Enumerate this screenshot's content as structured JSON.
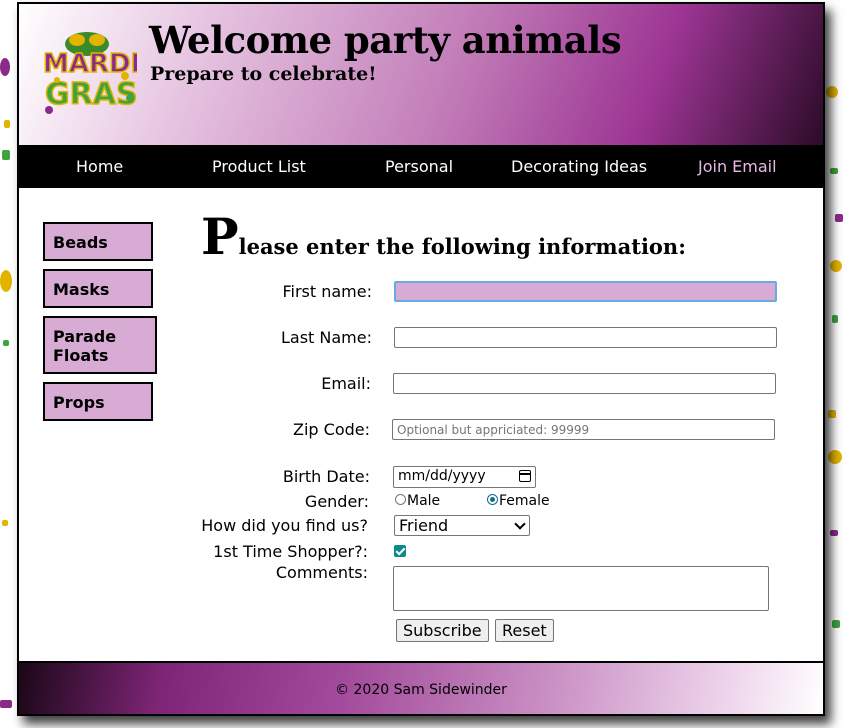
{
  "header": {
    "title": "Welcome party animals",
    "subtitle": "Prepare to celebrate!",
    "logo_text": "MARDI GRAS"
  },
  "nav": {
    "items": [
      "Home",
      "Product List",
      "Personal",
      "Decorating Ideas",
      "Join Email"
    ],
    "active": "Join Email"
  },
  "sidebar": {
    "items": [
      "Beads",
      "Masks",
      "Parade Floats",
      "Props"
    ]
  },
  "main": {
    "heading_first": "P",
    "heading_rest": "lease enter the following information:"
  },
  "form": {
    "first_name_label": "First name:",
    "last_name_label": "Last Name:",
    "email_label": "Email:",
    "zip_label": "Zip Code:",
    "zip_placeholder": "Optional but appriciated: 99999",
    "birth_label": "Birth Date:",
    "birth_placeholder": "mm/dd/yyyy",
    "gender_label": "Gender:",
    "gender_male": "Male",
    "gender_female": "Female",
    "gender_selected": "Female",
    "find_label": "How did you find us?",
    "find_selected": "Friend",
    "first_time_label": "1st Time Shopper?:",
    "first_time_checked": true,
    "comments_label": "Comments:",
    "subscribe_label": "Subscribe",
    "reset_label": "Reset"
  },
  "footer": {
    "text": "© 2020 Sam Sidewinder"
  },
  "colors": {
    "accent_purple": "#9c3593",
    "light_purple": "#d7abd4",
    "nav_active": "#e7b8e6",
    "check_teal": "#0f8a8a"
  }
}
